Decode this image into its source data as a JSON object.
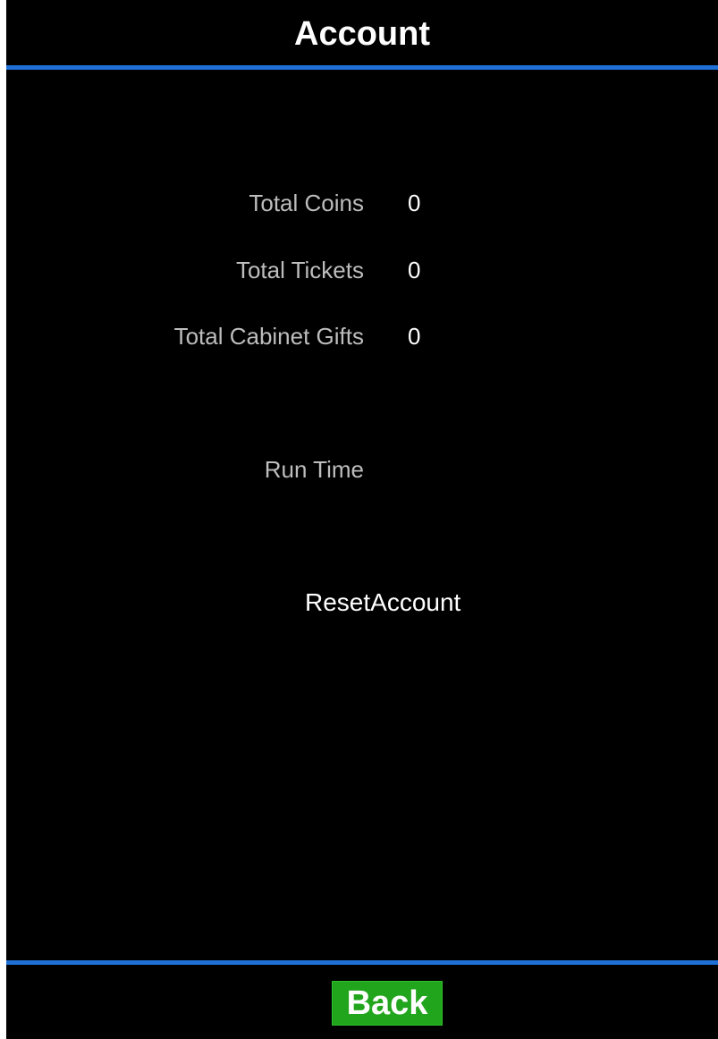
{
  "header": {
    "title": "Account"
  },
  "stats": [
    {
      "label": "Total Coins",
      "value": "0"
    },
    {
      "label": "Total Tickets",
      "value": "0"
    },
    {
      "label": "Total Cabinet Gifts",
      "value": "0"
    }
  ],
  "run_time": {
    "label": "Run Time",
    "value": ""
  },
  "actions": {
    "reset_label": "ResetAccount",
    "back_label": "Back"
  },
  "colors": {
    "background": "#000000",
    "accent_rule": "#1e6fd6",
    "back_button": "#21a51c",
    "label_text": "#bdbdbd",
    "value_text": "#ffffff"
  }
}
